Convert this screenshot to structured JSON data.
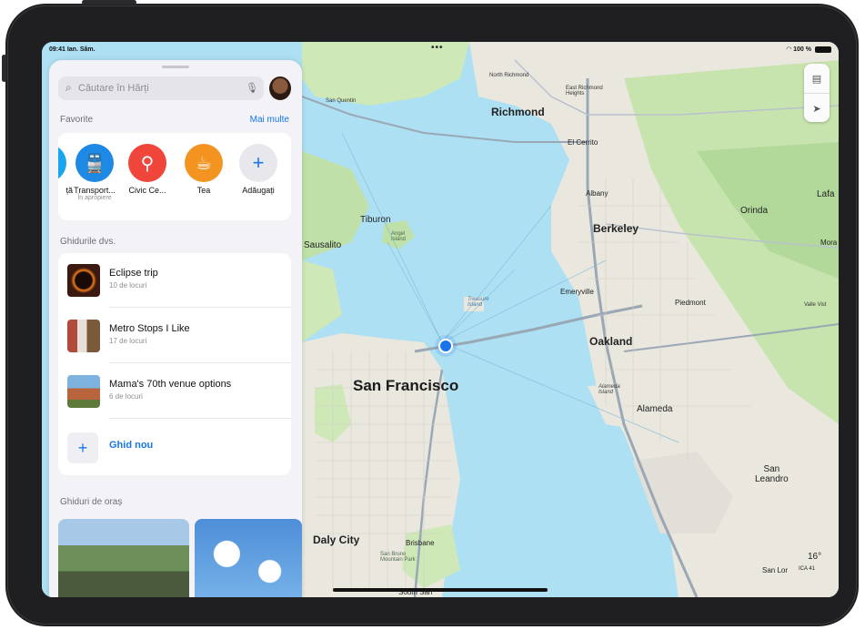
{
  "status": {
    "time": "09:41 Ian. Sâm.",
    "dots": "•••",
    "battery": "100 %"
  },
  "search": {
    "placeholder": "Căutare în Hărți"
  },
  "favorites": {
    "title": "Favorite",
    "more": "Mai multe",
    "items": [
      {
        "label": "ță",
        "sub": "",
        "color": "#1aa5f0",
        "icon": "partial-icon"
      },
      {
        "label": "Transport...",
        "sub": "În apropiere",
        "color": "#1e88e5",
        "icon": "train-icon"
      },
      {
        "label": "Civic Ce...",
        "sub": "",
        "color": "#f0453a",
        "icon": "pin-icon"
      },
      {
        "label": "Tea",
        "sub": "",
        "color": "#f39421",
        "icon": "cup-icon"
      },
      {
        "label": "Adăugați",
        "sub": "",
        "color": "#e7e7ec",
        "icon": "plus-icon"
      }
    ]
  },
  "guides": {
    "title": "Ghidurile dvs.",
    "items": [
      {
        "title": "Eclipse trip",
        "sub": "10 de locuri"
      },
      {
        "title": "Metro Stops I Like",
        "sub": "17 de locuri"
      },
      {
        "title": "Mama's 70th venue options",
        "sub": "6 de locuri"
      }
    ],
    "new": "Ghid nou"
  },
  "city_guides": {
    "title": "Ghiduri de oraș"
  },
  "map": {
    "labels": {
      "sf": "San Francisco",
      "oakland": "Oakland",
      "berkeley": "Berkeley",
      "richmond": "Richmond",
      "daly": "Daly City",
      "alameda": "Alameda",
      "sanleandro": "San\nLeandro",
      "tiburon": "Tiburon",
      "sausalito": "Sausalito",
      "elcerrito": "El Cerrito",
      "albany": "Albany",
      "emeryville": "Emeryville",
      "piedmont": "Piedmont",
      "orinda": "Orinda",
      "brisbane": "Brisbane",
      "sanquentin": "San Quentin",
      "northrichmond": "North Richmond",
      "eastrichmond": "East Richmond\nHeights",
      "lafa": "Lafa",
      "mora": "Mora",
      "valle": "Valle Vist",
      "southsan": "South San",
      "sanlor": "San Lor",
      "treasure": "Treasure\nIsland",
      "alamedaisland": "Alameda\nIsland",
      "angel": "Angel\nIsland",
      "sanbruno": "San Bruno\nMountain Park",
      "weather": "16°",
      "aqi": "ICA 41"
    }
  }
}
